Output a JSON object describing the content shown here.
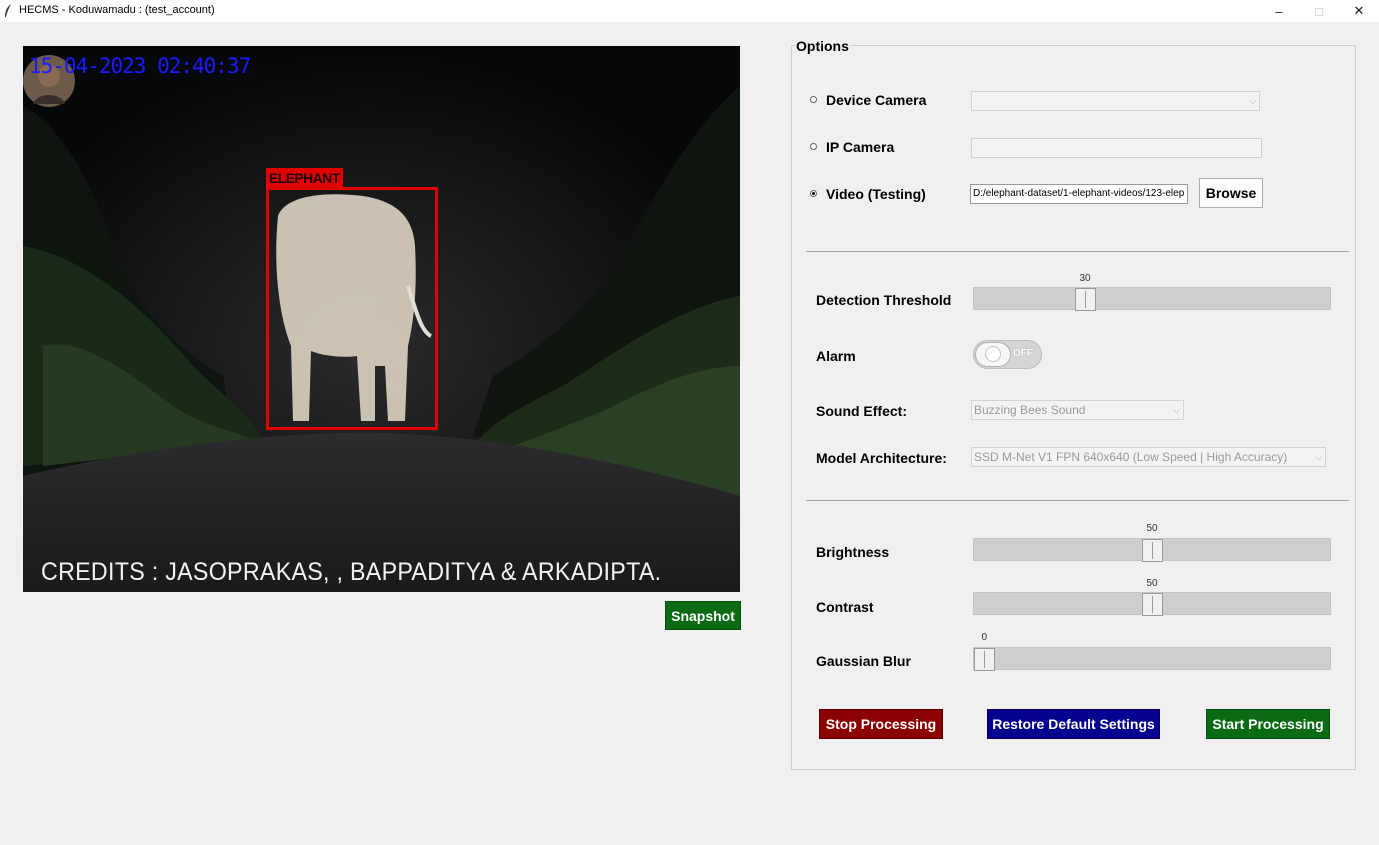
{
  "window": {
    "title": "HECMS - Koduwamadu : (test_account)",
    "app_icon": "feather-icon",
    "minimize_icon": "minimize-icon",
    "restore_icon": "restore-icon",
    "close_icon": "close-icon",
    "minimize_glyph": "–",
    "restore_glyph": "□",
    "close_glyph": "✕"
  },
  "video": {
    "timestamp": "15-04-2023 02:40:37",
    "detection_label": "ELEPHANT",
    "credits": "CREDITS : JASOPRAKAS, , BAPPADITYA &  ARKADIPTA.",
    "detection_color": "#e00000",
    "timestamp_color": "#1a1aff"
  },
  "snapshot_label": "Snapshot",
  "options": {
    "legend": "Options",
    "sources": {
      "device_camera_label": "Device Camera",
      "ip_camera_label": "IP Camera",
      "video_label": "Video (Testing)",
      "selected": "video",
      "device_camera_value": "",
      "ip_camera_value": "",
      "video_path": "D:/elephant-dataset/1-elephant-videos/123-elep",
      "browse_label": "Browse"
    },
    "detection_threshold": {
      "label": "Detection Threshold",
      "value": 30,
      "min": 0,
      "max": 100
    },
    "alarm": {
      "label": "Alarm",
      "state": "OFF"
    },
    "sound_effect": {
      "label": "Sound Effect:",
      "value": "Buzzing Bees Sound"
    },
    "model_architecture": {
      "label": "Model Architecture:",
      "value": "SSD M-Net V1 FPN 640x640 (Low Speed | High Accuracy)"
    },
    "brightness": {
      "label": "Brightness",
      "value": 50,
      "min": 0,
      "max": 100
    },
    "contrast": {
      "label": "Contrast",
      "value": 50,
      "min": 0,
      "max": 100
    },
    "gaussian_blur": {
      "label": "Gaussian Blur",
      "value": 0,
      "min": 0,
      "max": 100
    }
  },
  "actions": {
    "stop_label": "Stop Processing",
    "restore_label": "Restore Default Settings",
    "start_label": "Start Processing",
    "stop_color": "#8b0000",
    "restore_color": "#06008f",
    "start_color": "#0a6b14"
  }
}
